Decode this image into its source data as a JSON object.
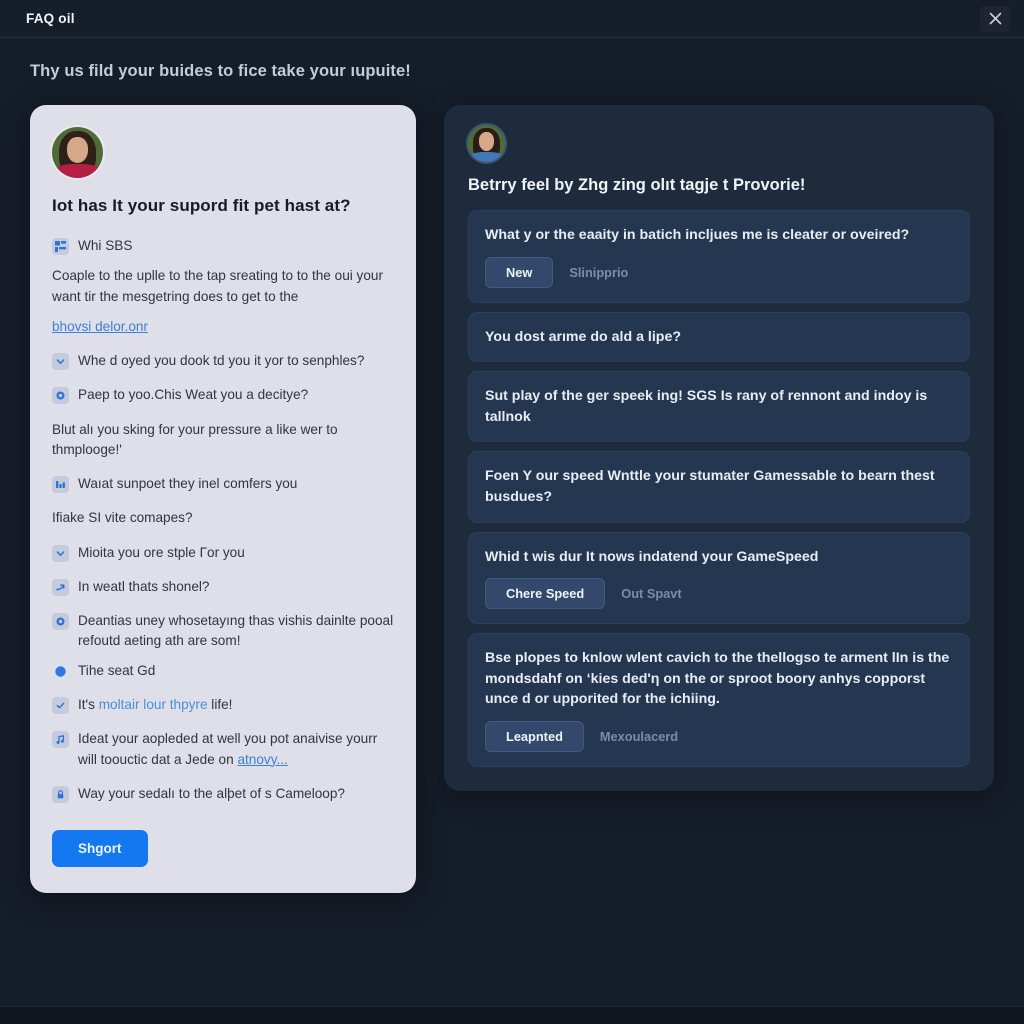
{
  "window": {
    "title": "FAQ oil",
    "close_icon": "close-icon"
  },
  "subtitle": "Thy us fild your buides to fice take your ıupuite!",
  "left_panel": {
    "avatar_alt": "user-avatar",
    "heading": "Iot has It your supord fit pet hast at?",
    "items": [
      {
        "icon": "chart-grid-icon",
        "text": "Whi SBS"
      },
      {
        "icon": "none",
        "text": "Coaple to the uplle to the tap sreating to to the oui your want tir the mesgetring does to get to the"
      },
      {
        "icon": "none",
        "text": "bhovsi delor.onr",
        "is_link": true
      },
      {
        "icon": "chevron-down-icon",
        "text": "Whe d oyed you dook td you it yor to senphles?"
      },
      {
        "icon": "circle-ring-icon",
        "text": "Paep to yoo.Chis Weat you a decitye?"
      },
      {
        "icon": "none",
        "text": "Blut alı you sking for your pressure a like wer to thmplooge!'"
      },
      {
        "icon": "bar-chart-icon",
        "text": "Waıat sunpoet they inel comfers you"
      },
      {
        "icon": "none",
        "text": "Ifiake SI vite comapes?"
      },
      {
        "icon": "chevron-down-icon",
        "text": "Mioita you ore stple Гor you"
      },
      {
        "icon": "arrow-icon",
        "text": "In weatl thats shonel?"
      },
      {
        "icon": "circle-ring-icon",
        "text": "Deantias uney whosetayıng thas vishis dainlte pooal refoutd aeting ath are som!"
      },
      {
        "icon": "circle-filled-icon",
        "text": "Tihe seat Gd"
      },
      {
        "icon": "check-icon",
        "text": "It's moltair lour thpyre life!",
        "link_part": "moltair lour thpyre"
      },
      {
        "icon": "note-icon",
        "text": "Ideat your aopleded at well you pot anaivise yourr will toouctic dat a Jede on ",
        "link_tail": "atnovy..."
      },
      {
        "icon": "lock-icon",
        "text": "Way your sedalı to the alþet of s Cameloop?"
      }
    ],
    "submit_label": "Shgort"
  },
  "right_panel": {
    "avatar_alt": "agent-avatar",
    "heading": "Betrry feel by Zhg zing olıt tagje t Provorie!",
    "questions": [
      {
        "text": "What y or the eaaity in batich incljues me is cleater or oveired?",
        "primary_action": "New",
        "secondary_action": "Slinipprio"
      },
      {
        "text": "You dost arıme do ald a lipe?",
        "primary_action": "",
        "secondary_action": ""
      },
      {
        "text": "Sut play of the ger speek ing! SGS Is rany of rennont and indoy is tallnok",
        "primary_action": "",
        "secondary_action": ""
      },
      {
        "text": "Foen Y our speed Wnttle your stumater Gamessable to bearn thest busdues?",
        "primary_action": "",
        "secondary_action": ""
      },
      {
        "text": "Whid t wis dur It nows indatend your GameSpeed",
        "primary_action": "Chere Speed",
        "secondary_action": "Out Spavt"
      },
      {
        "text": "Bse plopes to knlow wlent cavich to the thellogso te arment lIn is the mondsdahf on ‘kies ded'η on the or sproot boory anhys copporst unce d or upporited for the ichiing.",
        "primary_action": "Leapnted",
        "secondary_action": "Mexoulacerd"
      }
    ]
  },
  "colors": {
    "app_bg": "#151d29",
    "left_card_bg": "#dedfe8",
    "right_card_bg": "#1d2b3d",
    "qa_item_bg": "#253750",
    "accent_blue": "#1478f0",
    "link_blue": "#3d7fd1"
  }
}
